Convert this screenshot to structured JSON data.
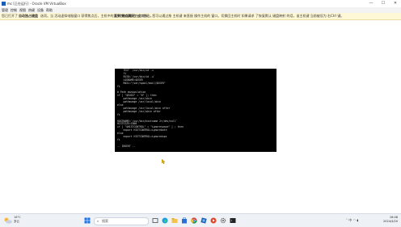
{
  "window": {
    "title": "mc [正在运行] - Oracle VM VirtualBox",
    "controls": [
      "—",
      "☐",
      "✕"
    ]
  },
  "menu": {
    "items": [
      "管理",
      "控制",
      "视图",
      "热键",
      "设备",
      "帮助"
    ]
  },
  "notification": {
    "prefix": "您已打开了",
    "bold1": "自动独占键盘",
    "middle": "选项。当 活动虚拟电脑窗口 获得焦点后，主机中的大多数热键都会 被其独占，",
    "bold2": "直到 焦点离开",
    "tail": "。在此 期间，您可以通过按 主机键 来直接 操作主机的 窗口。切换回主机时 如果请求 了恢复默认 键盘映射 的话，该主机键 当前被设为 右Ctrl 键。"
  },
  "console": {
    "text": "    TEXT  /usr/bin/id -u\n    fi\n    EUID=`/usr/bin/id -u`\n    LOGNAME=$USER\n    MAIL=\"/var/spool/mail/$USER\"\nfi\n\n# Path manipulation\nif [ \"$EUID\" = \"0\" ]; then\n    pathmunge /usr/sbin\n    pathmunge /usr/local/sbin\nelse\n    pathmunge /usr/local/sbin after\n    pathmunge /usr/sbin after\nfi\n\nHOSTNAME=`/usr/bin/hostname 2>/dev/null`\nHISTSIZE=1000\nif [ \"$HISTCONTROL\" = \"ignorespace\" ] ; then\n    export HISTCONTROL=ignoreboth\nelse\n    export HISTCONTROL=ignoredups\nfi\n\n-- INSERT --"
  },
  "taskbar": {
    "weather_temp": "16°C",
    "weather_desc": "多云",
    "search_placeholder": "搜索",
    "tray_lang": "中",
    "time": "16:48",
    "date": "2024/4/20",
    "app_icons": [
      "windows-icon",
      "task-view-icon",
      "edge-icon",
      "file-explorer-icon",
      "store-icon",
      "chrome-icon",
      "virtualbox-icon",
      "media-icon",
      "settings-icon",
      "terminal-icon"
    ],
    "accent": "#1a5fb4"
  }
}
